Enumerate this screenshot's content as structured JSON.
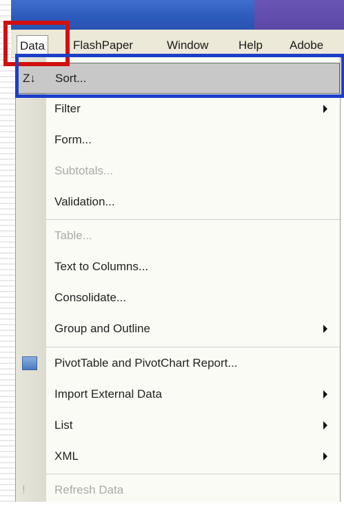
{
  "menubar": {
    "items": [
      {
        "label": "Data",
        "active": true
      },
      {
        "label": "FlashPaper"
      },
      {
        "label": "Window"
      },
      {
        "label": "Help"
      },
      {
        "label": "Adobe"
      }
    ]
  },
  "data_menu": {
    "items": [
      {
        "label": "Sort...",
        "selected": true,
        "icon": "sort-descending-icon"
      },
      {
        "label": "Filter",
        "submenu": true
      },
      {
        "label": "Form..."
      },
      {
        "label": "Subtotals...",
        "disabled": true
      },
      {
        "label": "Validation..."
      },
      {
        "label": "Table...",
        "disabled": true
      },
      {
        "label": "Text to Columns..."
      },
      {
        "label": "Consolidate..."
      },
      {
        "label": "Group and Outline",
        "submenu": true
      },
      {
        "label": "PivotTable and PivotChart Report...",
        "icon": "pivot-table-icon"
      },
      {
        "label": "Import External Data",
        "submenu": true
      },
      {
        "label": "List",
        "submenu": true
      },
      {
        "label": "XML",
        "submenu": true
      },
      {
        "label": "Refresh Data",
        "disabled": true,
        "icon": "exclamation-icon"
      }
    ]
  },
  "colors": {
    "titlebar": "#2d5bbd",
    "menubar": "#ece9d8",
    "highlight_red": "#d10f0f",
    "highlight_blue": "#1b3fc7",
    "selected_row": "#c8c8c8"
  }
}
